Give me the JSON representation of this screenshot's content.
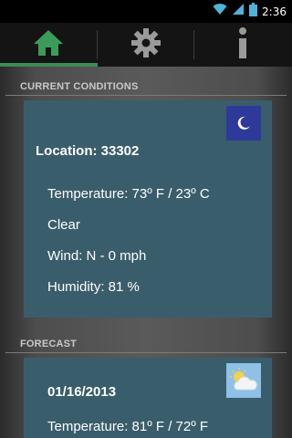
{
  "status_bar": {
    "time": "2:36",
    "icons": [
      "wifi-icon",
      "signal-icon",
      "battery-icon"
    ]
  },
  "tabs": [
    {
      "name": "home",
      "icon": "home-icon",
      "active": true
    },
    {
      "name": "settings",
      "icon": "gear-icon",
      "active": false
    },
    {
      "name": "info",
      "icon": "info-icon",
      "active": false
    }
  ],
  "current": {
    "header": "CURRENT CONDITIONS",
    "location": "Location: 33302",
    "temperature": "Temperature: 73º F / 23º C",
    "condition": "Clear",
    "wind": "Wind: N - 0 mph",
    "humidity": "Humidity: 81 %",
    "icon": "moon-icon"
  },
  "forecast": {
    "header": "FORECAST",
    "date": "01/16/2013",
    "temperature": "Temperature: 81º F / 72º F",
    "icon": "partly-cloudy-icon"
  },
  "colors": {
    "accent": "#3b8d54",
    "card": "#3a5d6b",
    "night_icon_bg": "#2e3a9a",
    "day_icon_bg": "#8fc0e6"
  }
}
